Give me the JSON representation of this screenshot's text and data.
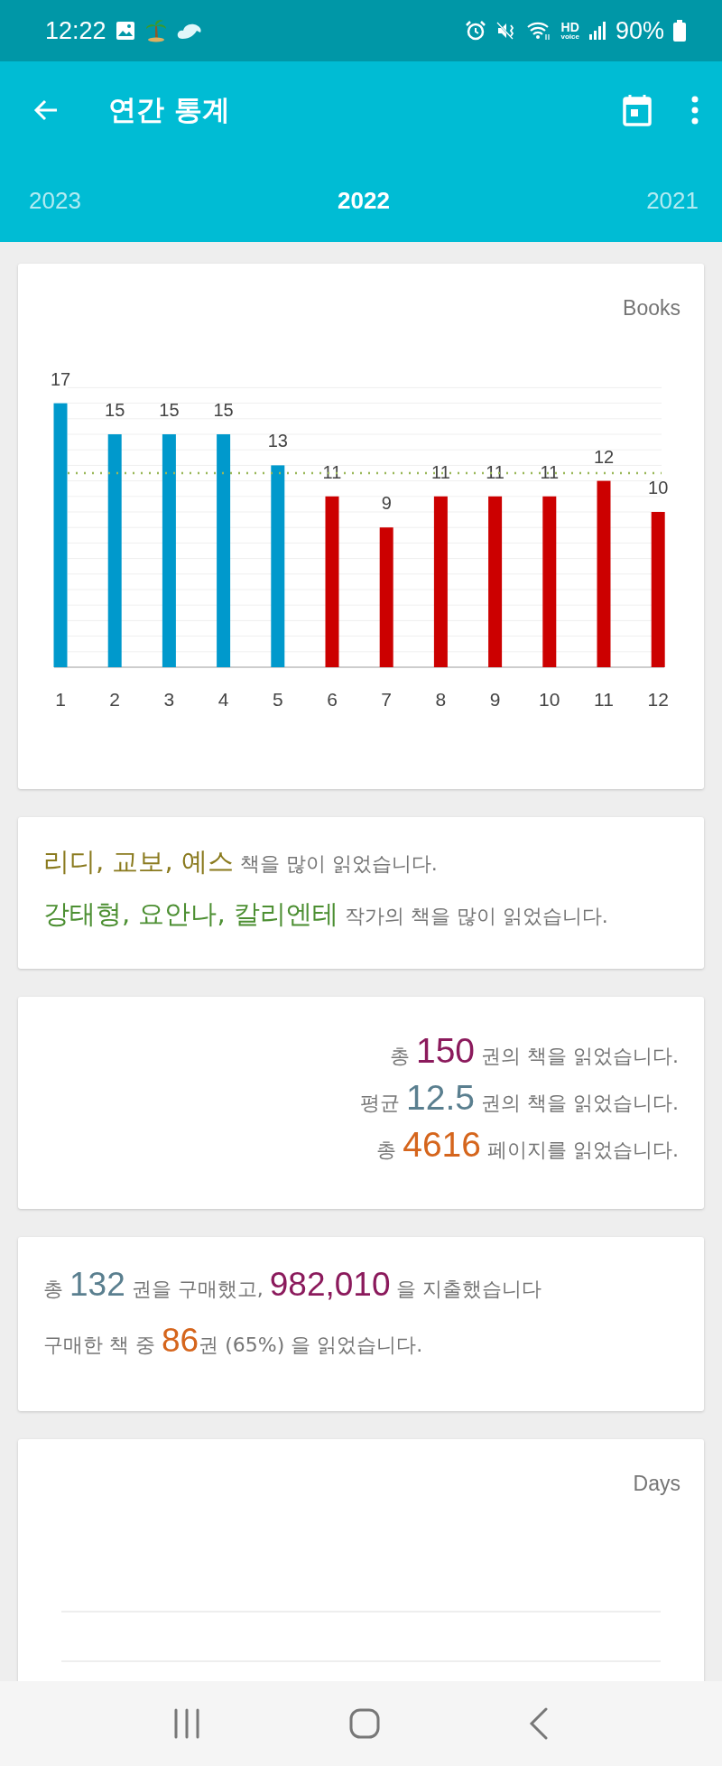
{
  "status_bar": {
    "time": "12:22",
    "hd_voice": [
      "HD",
      "voice"
    ],
    "battery": "90%"
  },
  "app_bar": {
    "title": "연간 통계"
  },
  "years": [
    {
      "label": "2023",
      "selected": false
    },
    {
      "label": "2022",
      "selected": true
    },
    {
      "label": "2021",
      "selected": false
    }
  ],
  "books_chart": {
    "chart_data": {
      "type": "bar",
      "ylabel": "Books",
      "categories": [
        "1",
        "2",
        "3",
        "4",
        "5",
        "6",
        "7",
        "8",
        "9",
        "10",
        "11",
        "12"
      ],
      "ylim": [
        0,
        18
      ],
      "data_labels": true,
      "series": [
        {
          "color": "#0099cc",
          "values": [
            17,
            15,
            15,
            15,
            13,
            null,
            null,
            null,
            null,
            null,
            null,
            null
          ]
        },
        {
          "color": "#cc0000",
          "values": [
            null,
            null,
            null,
            null,
            null,
            11,
            9,
            11,
            11,
            11,
            12,
            10
          ]
        }
      ]
    }
  },
  "favorites": [
    {
      "parts": [
        {
          "text": "리디, 교보, 예스",
          "color": "#8a7a1e"
        },
        {
          "text": "책을 많이 읽었습니다."
        }
      ]
    },
    {
      "parts": [
        {
          "text": "강태형, 요안나, 칼리엔테",
          "color": "#4c8f32"
        },
        {
          "text": "작가의 책을 많이 읽었습니다."
        }
      ]
    }
  ],
  "reading_totals": [
    {
      "parts": [
        {
          "text": "총"
        },
        {
          "text": "150",
          "color": "#8b1a5c"
        },
        {
          "text": "권의 책을 읽었습니다."
        }
      ]
    },
    {
      "parts": [
        {
          "text": "평균"
        },
        {
          "text": "12.5",
          "color": "#5a7f8f"
        },
        {
          "text": "권의 책을 읽었습니다."
        }
      ]
    },
    {
      "parts": [
        {
          "text": "총"
        },
        {
          "text": "4616",
          "color": "#d5651c"
        },
        {
          "text": "페이지를 읽었습니다."
        }
      ]
    }
  ],
  "purchases": [
    {
      "parts": [
        {
          "text": "총"
        },
        {
          "text": "132",
          "color": "#5a7f8f"
        },
        {
          "text": "권을 구매했고,"
        },
        {
          "text": "982,010",
          "color": "#8b1a5c"
        },
        {
          "text": "을 지출했습니다"
        }
      ]
    },
    {
      "parts": [
        {
          "text": "구매한 책 중"
        },
        {
          "text": "86",
          "color": "#d5651c"
        },
        {
          "text": "권 (65%) 을 읽었습니다.",
          "attached": true
        }
      ]
    }
  ],
  "days_chart": {
    "label": "Days"
  }
}
